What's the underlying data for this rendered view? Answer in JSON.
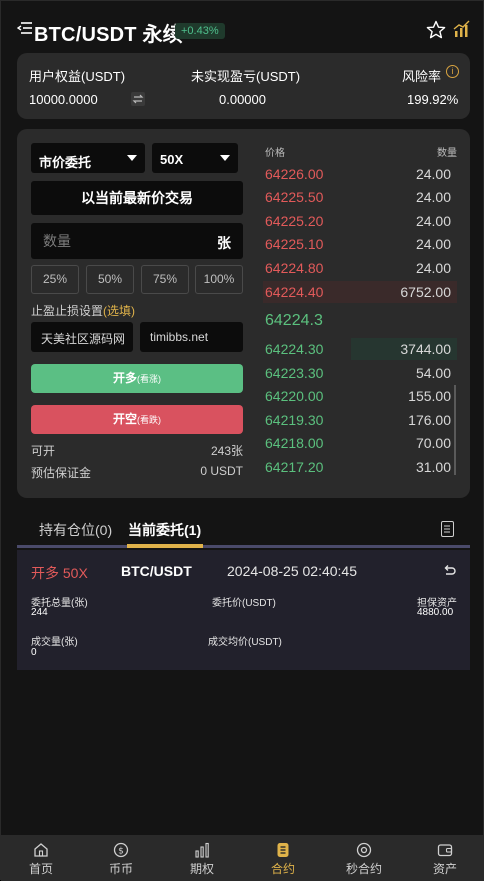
{
  "header": {
    "title": "BTC/USDT 永续",
    "change": "+0.43%"
  },
  "stats": {
    "equity_label": "用户权益(USDT)",
    "equity_value": "10000.0000",
    "pnl_label": "未实现盈亏(USDT)",
    "pnl_value": "0.00000",
    "risk_label": "风险率",
    "risk_value": "199.92%"
  },
  "trade": {
    "order_type": "市价委托",
    "leverage": "50X",
    "latest_price_button": "以当前最新价交易",
    "quantity_placeholder": "数量",
    "quantity_unit": "张",
    "percent_buttons": [
      "25%",
      "50%",
      "75%",
      "100%"
    ],
    "tpsl_label": "止盈止损设置",
    "tpsl_optional": "(选填)",
    "tp_input": "天美社区源码网",
    "sl_input": "timibbs.net",
    "buy_label": "开多",
    "buy_sub": "(看涨)",
    "sell_label": "开空",
    "sell_sub": "(看跌)",
    "available_label": "可开",
    "available_value": "243张",
    "margin_label": "预估保证金",
    "margin_value": "0 USDT"
  },
  "orderbook": {
    "price_header": "价格",
    "amount_header": "数量",
    "asks": [
      {
        "price": "64226.00",
        "amount": "24.00"
      },
      {
        "price": "64225.50",
        "amount": "24.00"
      },
      {
        "price": "64225.20",
        "amount": "24.00"
      },
      {
        "price": "64225.10",
        "amount": "24.00"
      },
      {
        "price": "64224.80",
        "amount": "24.00"
      },
      {
        "price": "64224.40",
        "amount": "6752.00"
      }
    ],
    "last_price": "64224.3",
    "bids": [
      {
        "price": "64224.30",
        "amount": "3744.00"
      },
      {
        "price": "64223.30",
        "amount": "54.00"
      },
      {
        "price": "64220.00",
        "amount": "155.00"
      },
      {
        "price": "64219.30",
        "amount": "176.00"
      },
      {
        "price": "64218.00",
        "amount": "70.00"
      },
      {
        "price": "64217.20",
        "amount": "31.00"
      }
    ]
  },
  "tabs": {
    "positions": "持有仓位(0)",
    "orders": "当前委托(1)"
  },
  "order": {
    "side": "开多 50X",
    "pair": "BTC/USDT",
    "time": "2024-08-25 02:40:45",
    "total_label": "委托总量(张)",
    "total_value": "244",
    "price_label": "委托价(USDT)",
    "collateral_label": "担保资产",
    "collateral_value": "4880.00",
    "filled_label": "成交量(张)",
    "filled_value": "0",
    "avg_label": "成交均价(USDT)"
  },
  "nav": [
    {
      "label": "首页",
      "icon": "home-icon"
    },
    {
      "label": "币币",
      "icon": "coin-icon"
    },
    {
      "label": "期权",
      "icon": "bar-chart-icon"
    },
    {
      "label": "合约",
      "icon": "contract-icon"
    },
    {
      "label": "秒合约",
      "icon": "target-icon"
    },
    {
      "label": "资产",
      "icon": "wallet-icon"
    }
  ],
  "colors": {
    "up": "#5bc07e",
    "down": "#e25a5a",
    "accent": "#e0b34a"
  }
}
